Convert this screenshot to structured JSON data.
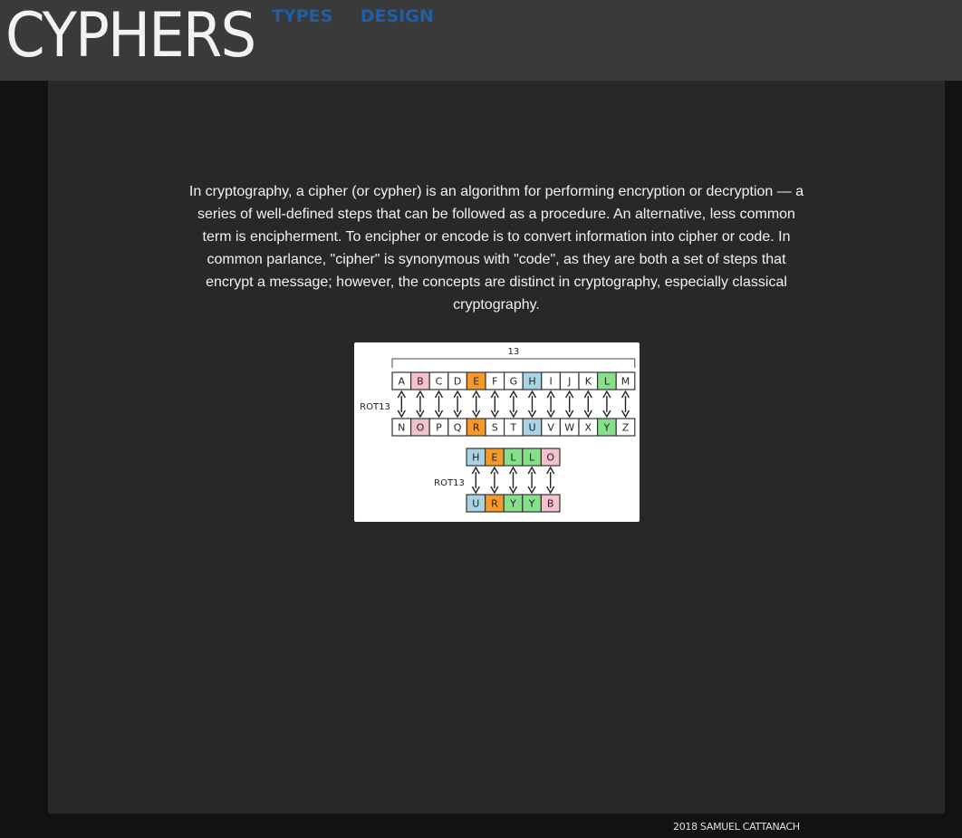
{
  "header": {
    "logo": "CYPHERS",
    "nav": [
      "TYPES",
      "DESIGN"
    ]
  },
  "main": {
    "intro": "In cryptography, a cipher (or cypher) is an algorithm for performing encryption or decryption — a series of well-defined steps that can be followed as a procedure. An alternative, less common term is encipherment. To encipher or encode is to convert information into cipher or code. In common parlance, \"cipher\" is synonymous with \"code\", as they are both a set of steps that encrypt a message; however, the concepts are distinct in cryptography, especially classical cryptography.",
    "diagram": {
      "shift_label": "13",
      "rot_label": "ROT13",
      "top_row": [
        "A",
        "B",
        "C",
        "D",
        "E",
        "F",
        "G",
        "H",
        "I",
        "J",
        "K",
        "L",
        "M"
      ],
      "bottom_row": [
        "N",
        "O",
        "P",
        "Q",
        "R",
        "S",
        "T",
        "U",
        "V",
        "W",
        "X",
        "Y",
        "Z"
      ],
      "word_plain": [
        "H",
        "E",
        "L",
        "L",
        "O"
      ],
      "word_cipher": [
        "U",
        "R",
        "Y",
        "Y",
        "B"
      ],
      "highlight_colors": {
        "B": "#f5c1cc",
        "O": "#f5c1cc",
        "E": "#f39a2b",
        "R": "#f39a2b",
        "H": "#a9d3e3",
        "U": "#a9d3e3",
        "L": "#86e08a",
        "Y": "#86e08a"
      }
    }
  },
  "footer": {
    "credit": "2018 SAMUEL CATTANACH"
  }
}
